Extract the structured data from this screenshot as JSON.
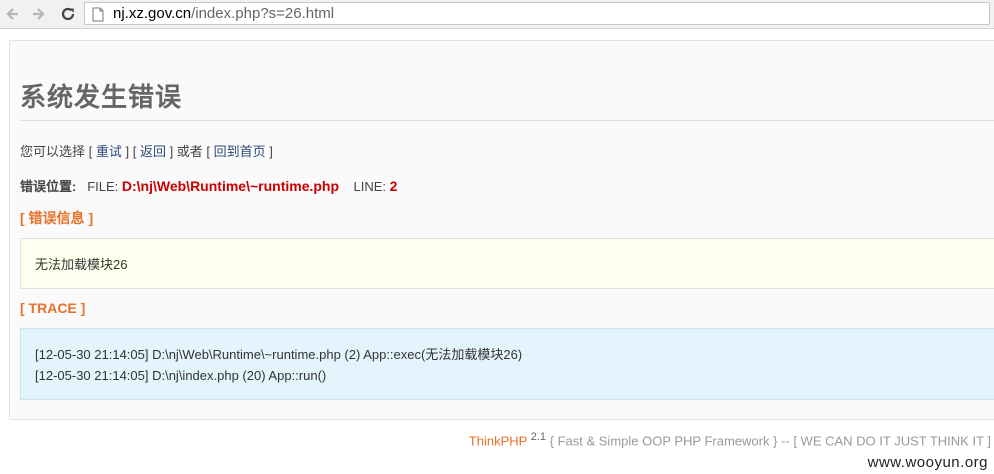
{
  "browser": {
    "url_domain": "nj.xz.gov.cn",
    "url_path": "/index.php?s=26.html"
  },
  "page": {
    "title": "系统发生错误",
    "options": {
      "prefix": "您可以选择",
      "retry": "重试",
      "back": "返回",
      "or": "或者",
      "home": "回到首页"
    },
    "location": {
      "label": "错误位置:",
      "file_label": "FILE:",
      "file": "D:\\nj\\Web\\Runtime\\~runtime.php",
      "line_label": "LINE:",
      "line": "2"
    },
    "info_heading": "[ 错误信息 ]",
    "info_message": "无法加载模块26",
    "trace_heading": "[ TRACE ]",
    "trace": [
      "[12-05-30 21:14:05] D:\\nj\\Web\\Runtime\\~runtime.php (2) App::exec(无法加载模块26)",
      "[12-05-30 21:14:05] D:\\nj\\index.php (20) App::run()"
    ]
  },
  "footer": {
    "brand": "ThinkPHP",
    "version": "2.1",
    "tagline": "{ Fast & Simple OOP PHP Framework } -- [ WE CAN DO IT JUST THINK IT ]"
  },
  "watermark": "www.wooyun.org",
  "colors": {
    "accent_orange": "#e8722a",
    "error_red": "#cc0000",
    "info_bg": "#ffffee",
    "trace_bg": "#e3f4fc"
  },
  "icons": [
    "back-arrow-icon",
    "forward-arrow-icon",
    "reload-icon",
    "page-icon"
  ]
}
